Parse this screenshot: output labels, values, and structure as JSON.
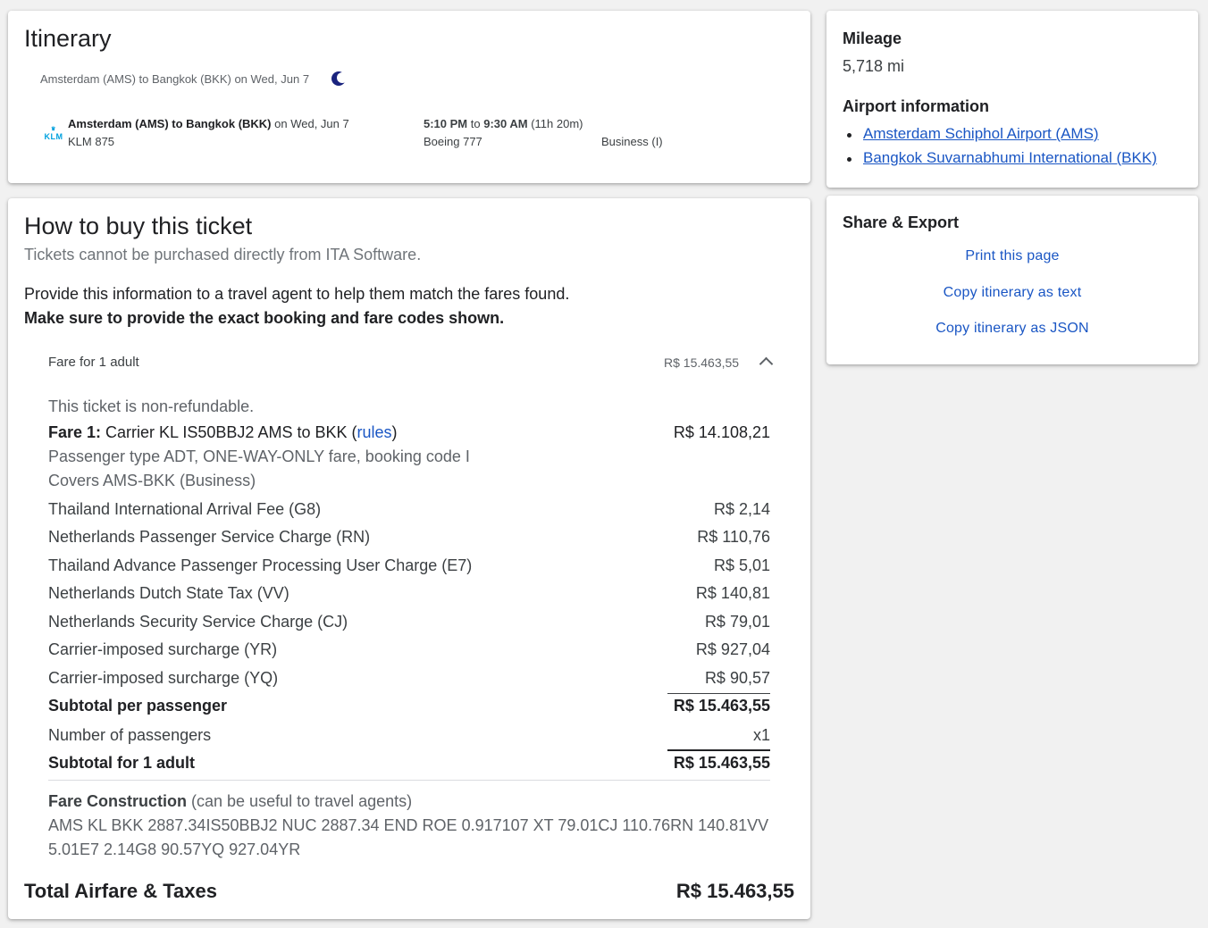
{
  "itinerary": {
    "title": "Itinerary",
    "summary": "Amsterdam (AMS) to Bangkok (BKK) on Wed, Jun 7",
    "airline_logo": "KLM",
    "route_bold": "Amsterdam (AMS) to Bangkok (BKK)",
    "route_date": " on Wed, Jun 7",
    "flight_number": "KLM 875",
    "depart_time": "5:10 PM",
    "to_word": " to ",
    "arrive_time": "9:30 AM",
    "duration": " (11h 20m)",
    "aircraft": "Boeing 777",
    "cabin": "Business (I)"
  },
  "buy": {
    "title": "How to buy this ticket",
    "subtitle": "Tickets cannot be purchased directly from ITA Software.",
    "instructions": "Provide this information to a travel agent to help them match the fares found.",
    "instructions_bold": "Make sure to provide the exact booking and fare codes shown.",
    "fare_header_label": "Fare for 1 adult",
    "fare_header_amount": "R$ 15.463,55",
    "non_refundable": "This ticket is non-refundable.",
    "fare1_label": "Fare 1:",
    "fare1_desc": " Carrier KL IS50BBJ2 AMS to BKK (",
    "fare1_rules": "rules",
    "fare1_close": ")",
    "fare1_amount": "R$ 14.108,21",
    "fare1_line2": "Passenger type ADT, ONE-WAY-ONLY fare, booking code I",
    "fare1_line3": "Covers AMS-BKK (Business)",
    "taxes": [
      {
        "label": "Thailand International Arrival Fee (G8)",
        "amount": "R$ 2,14"
      },
      {
        "label": "Netherlands Passenger Service Charge (RN)",
        "amount": "R$ 110,76"
      },
      {
        "label": "Thailand Advance Passenger Processing User Charge (E7)",
        "amount": "R$ 5,01"
      },
      {
        "label": "Netherlands Dutch State Tax (VV)",
        "amount": "R$ 140,81"
      },
      {
        "label": "Netherlands Security Service Charge (CJ)",
        "amount": "R$ 79,01"
      },
      {
        "label": "Carrier-imposed surcharge (YR)",
        "amount": "R$ 927,04"
      },
      {
        "label": "Carrier-imposed surcharge (YQ)",
        "amount": "R$ 90,57"
      }
    ],
    "subtotal_pp_label": "Subtotal per passenger",
    "subtotal_pp_amount": "R$ 15.463,55",
    "num_pax_label": "Number of passengers",
    "num_pax_value": "x1",
    "subtotal_adult_label": "Subtotal for 1 adult",
    "subtotal_adult_amount": "R$ 15.463,55",
    "fare_construction_label": "Fare Construction",
    "fare_construction_note": " (can be useful to travel agents)",
    "fare_construction_line1": "AMS KL BKK 2887.34IS50BBJ2 NUC 2887.34 END ROE 0.917107 XT 79.01CJ 110.76RN 140.81VV",
    "fare_construction_line2": "5.01E7 2.14G8 90.57YQ 927.04YR",
    "total_label": "Total Airfare & Taxes",
    "total_amount": "R$ 15.463,55"
  },
  "mileage": {
    "title": "Mileage",
    "value": "5,718 mi",
    "airport_title": "Airport information",
    "airports": [
      "Amsterdam Schiphol Airport (AMS)",
      "Bangkok Suvarnabhumi International (BKK)"
    ]
  },
  "share": {
    "title": "Share & Export",
    "print": "Print this page",
    "copy_text": "Copy itinerary as text",
    "copy_json": "Copy itinerary as JSON"
  },
  "colors": {
    "link": "#1a56c4",
    "background": "#f1f1f1",
    "moon": "#1a237e",
    "klm": "#00a1de"
  },
  "icons": [
    "moon-icon",
    "klm-logo",
    "chevron-up-icon"
  ]
}
